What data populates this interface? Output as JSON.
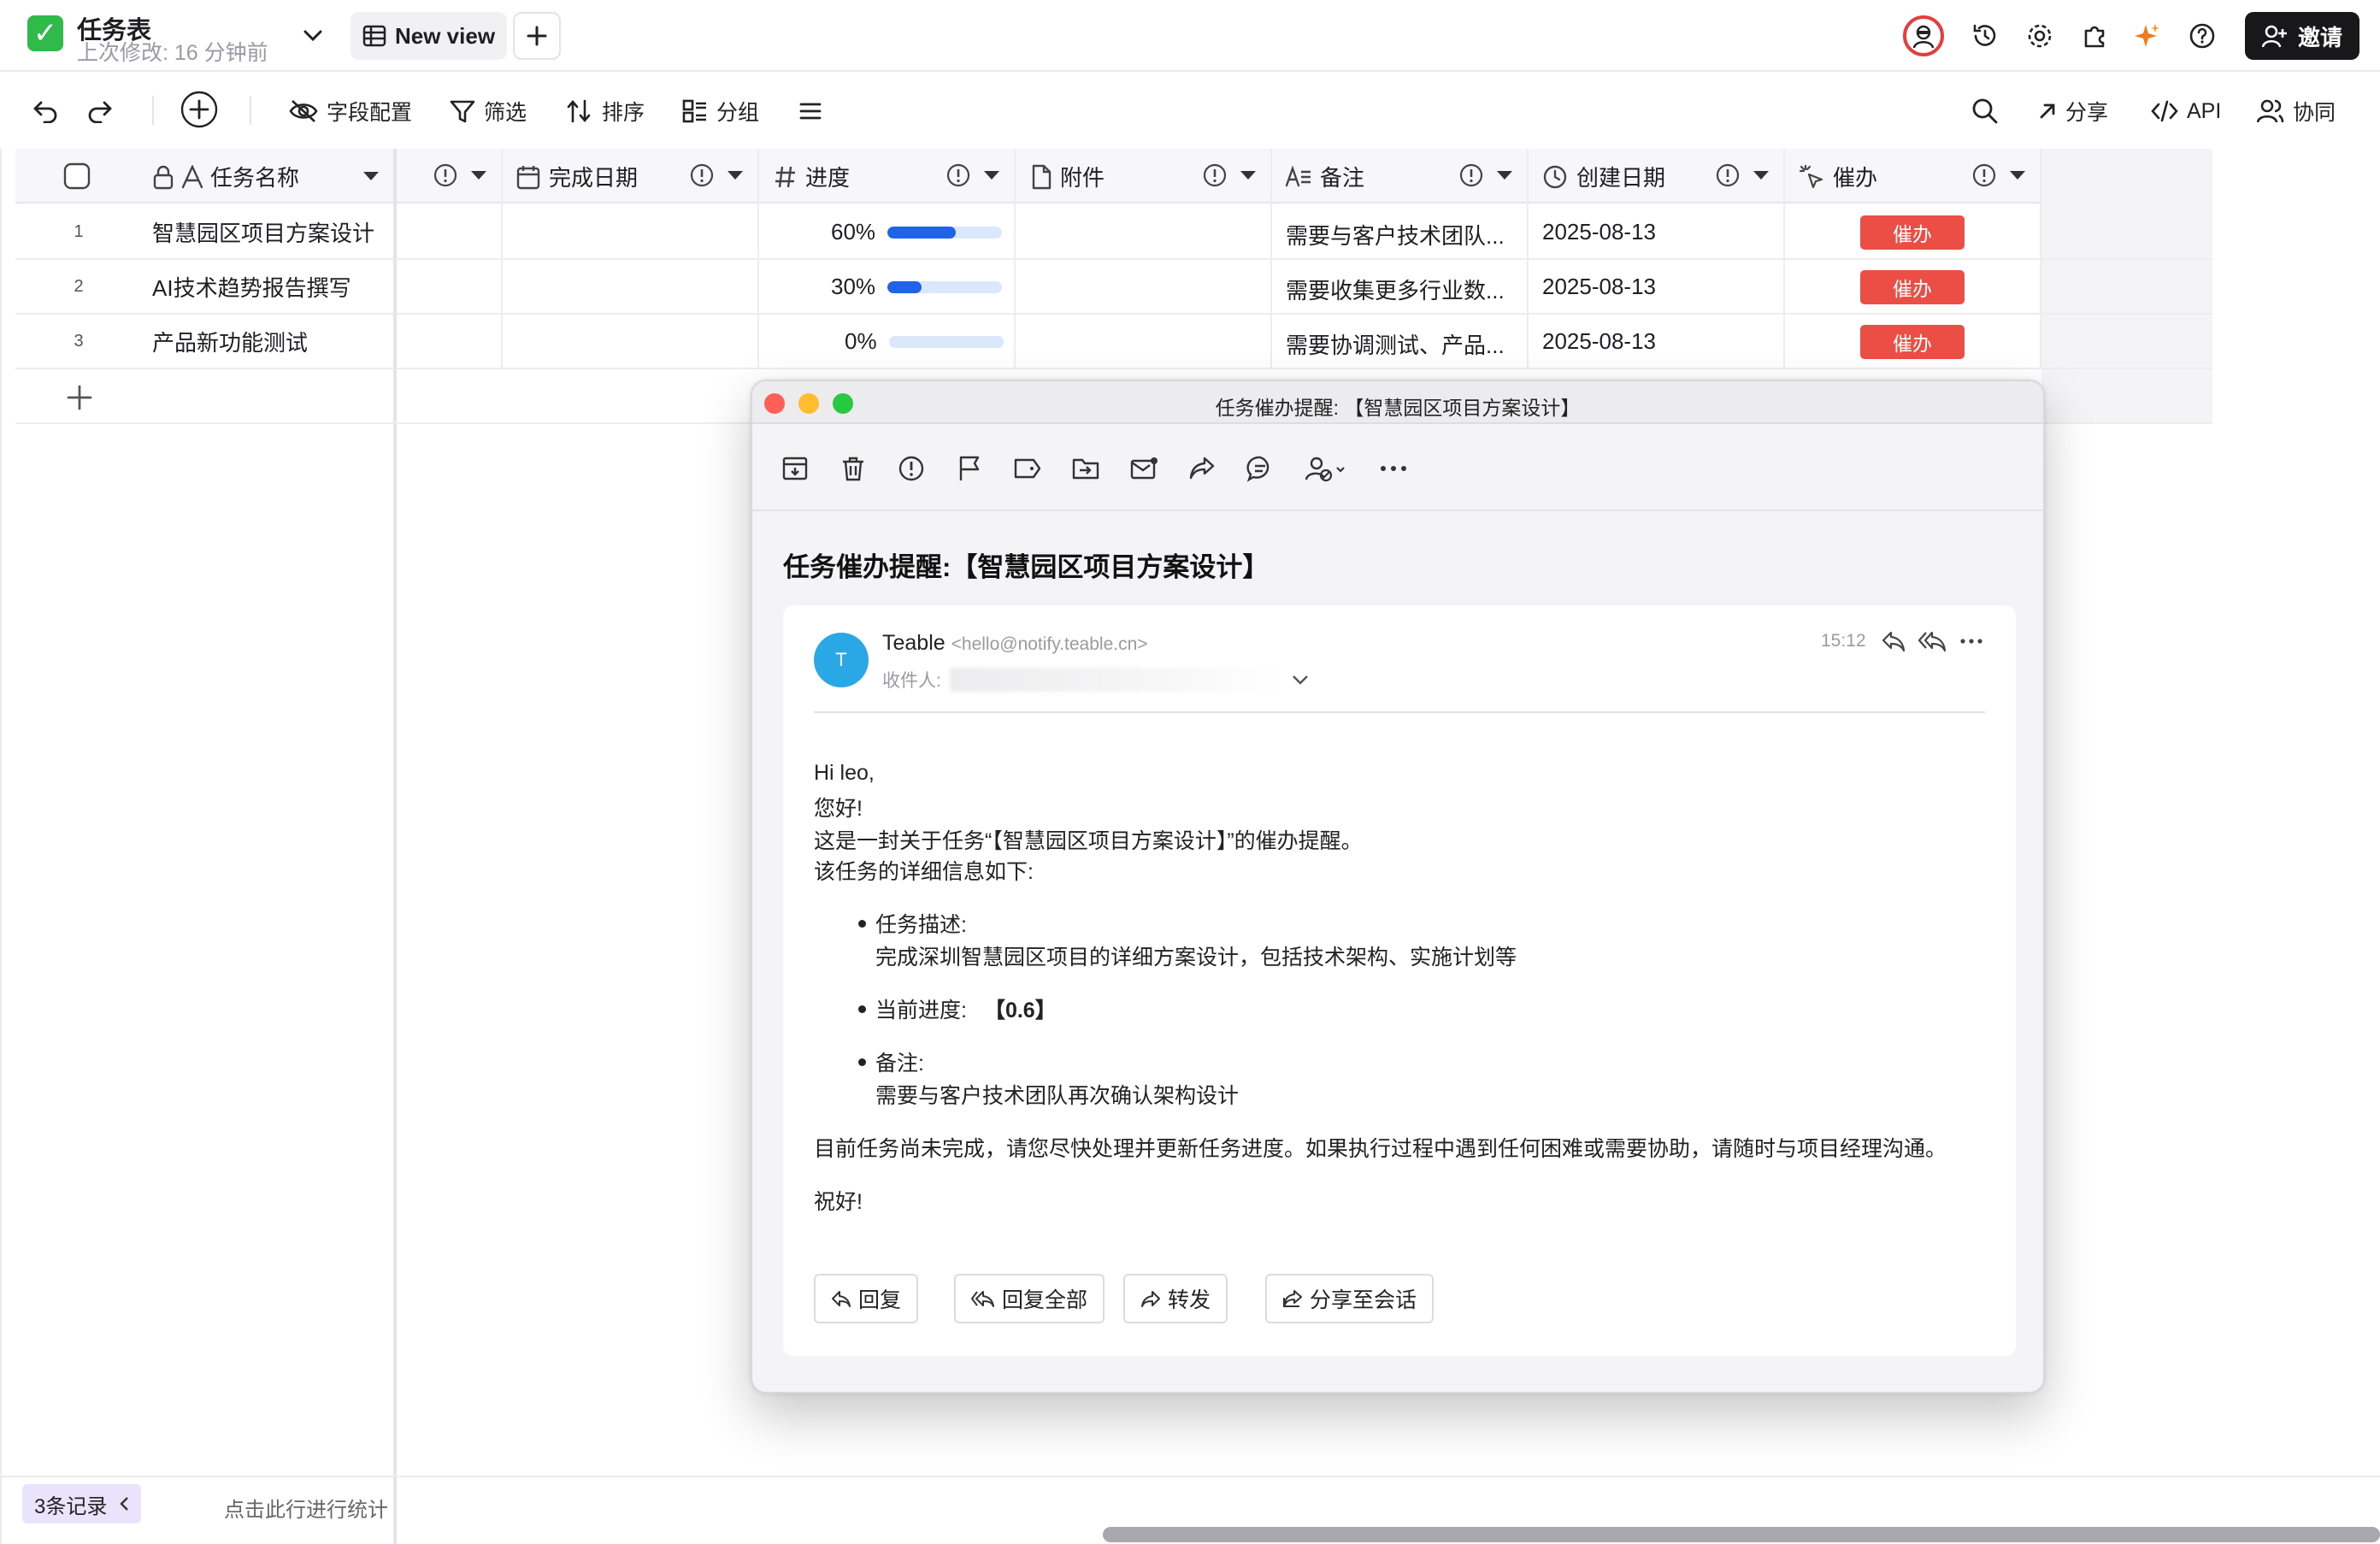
{
  "app": {
    "title": "任务表",
    "last_modified": "上次修改:  16 分钟前",
    "view_name": "New view",
    "invite_label": "邀请"
  },
  "toolbar": {
    "fields_label": "字段配置",
    "filter_label": "筛选",
    "sort_label": "排序",
    "group_label": "分组",
    "share_label": "分享",
    "api_label": "API",
    "collab_label": "协同"
  },
  "table": {
    "columns": [
      {
        "name": "任务名称",
        "icon": "text-icon"
      },
      {
        "name": "",
        "icon": "info-icon"
      },
      {
        "name": "完成日期",
        "icon": "calendar-icon"
      },
      {
        "name": "进度",
        "icon": "hash-icon"
      },
      {
        "name": "附件",
        "icon": "file-icon"
      },
      {
        "name": "备注",
        "icon": "long-text-icon"
      },
      {
        "name": "创建日期",
        "icon": "clock-icon"
      },
      {
        "name": "催办",
        "icon": "click-icon"
      }
    ],
    "rows": [
      {
        "num": "1",
        "name": "智慧园区项目方案设计",
        "progress": 0.6,
        "progress_label": "60%",
        "note": "需要与客户技术团队...",
        "created": "2025-08-13",
        "button": "催办"
      },
      {
        "num": "2",
        "name": "AI技术趋势报告撰写",
        "progress": 0.3,
        "progress_label": "30%",
        "note": "需要收集更多行业数...",
        "created": "2025-08-13",
        "button": "催办"
      },
      {
        "num": "3",
        "name": "产品新功能测试",
        "progress": 0.0,
        "progress_label": "0%",
        "note": "需要协调测试、产品...",
        "created": "2025-08-13",
        "button": "催办"
      }
    ]
  },
  "status": {
    "record_count": "3条记录",
    "stats_hint": "点击此行进行统计"
  },
  "mail": {
    "window_title": "任务催办提醒: 【智慧园区项目方案设计】",
    "subject": "任务催办提醒:【智慧园区项目方案设计】",
    "sender_initial": "T",
    "sender_name": "Teable",
    "sender_addr": "<hello@notify.teable.cn>",
    "recipient_label": "收件人:",
    "time": "15:12",
    "greeting": "Hi leo,",
    "hello": "您好!",
    "intro": "这是一封关于任务“【智慧园区项目方案设计】”的催办提醒。",
    "detail_intro": "该任务的详细信息如下:",
    "desc_label": "任务描述:",
    "desc_value": "完成深圳智慧园区项目的详细方案设计，包括技术架构、实施计划等",
    "progress_label": "当前进度:",
    "progress_value": "【0.6】",
    "note_label": "备注:",
    "note_value": "需要与客户技术团队再次确认架构设计",
    "closing": "目前任务尚未完成，请您尽快处理并更新任务进度。如果执行过程中遇到任何困难或需要协助，请随时与项目经理沟通。",
    "signoff": "祝好!",
    "buttons": {
      "reply": "回复",
      "reply_all": "回复全部",
      "forward": "转发",
      "share": "分享至会话"
    }
  },
  "colors": {
    "accent_blue": "#1e63e9",
    "urge_red": "#ea4e45",
    "sender_avatar": "#2aa8e6"
  }
}
